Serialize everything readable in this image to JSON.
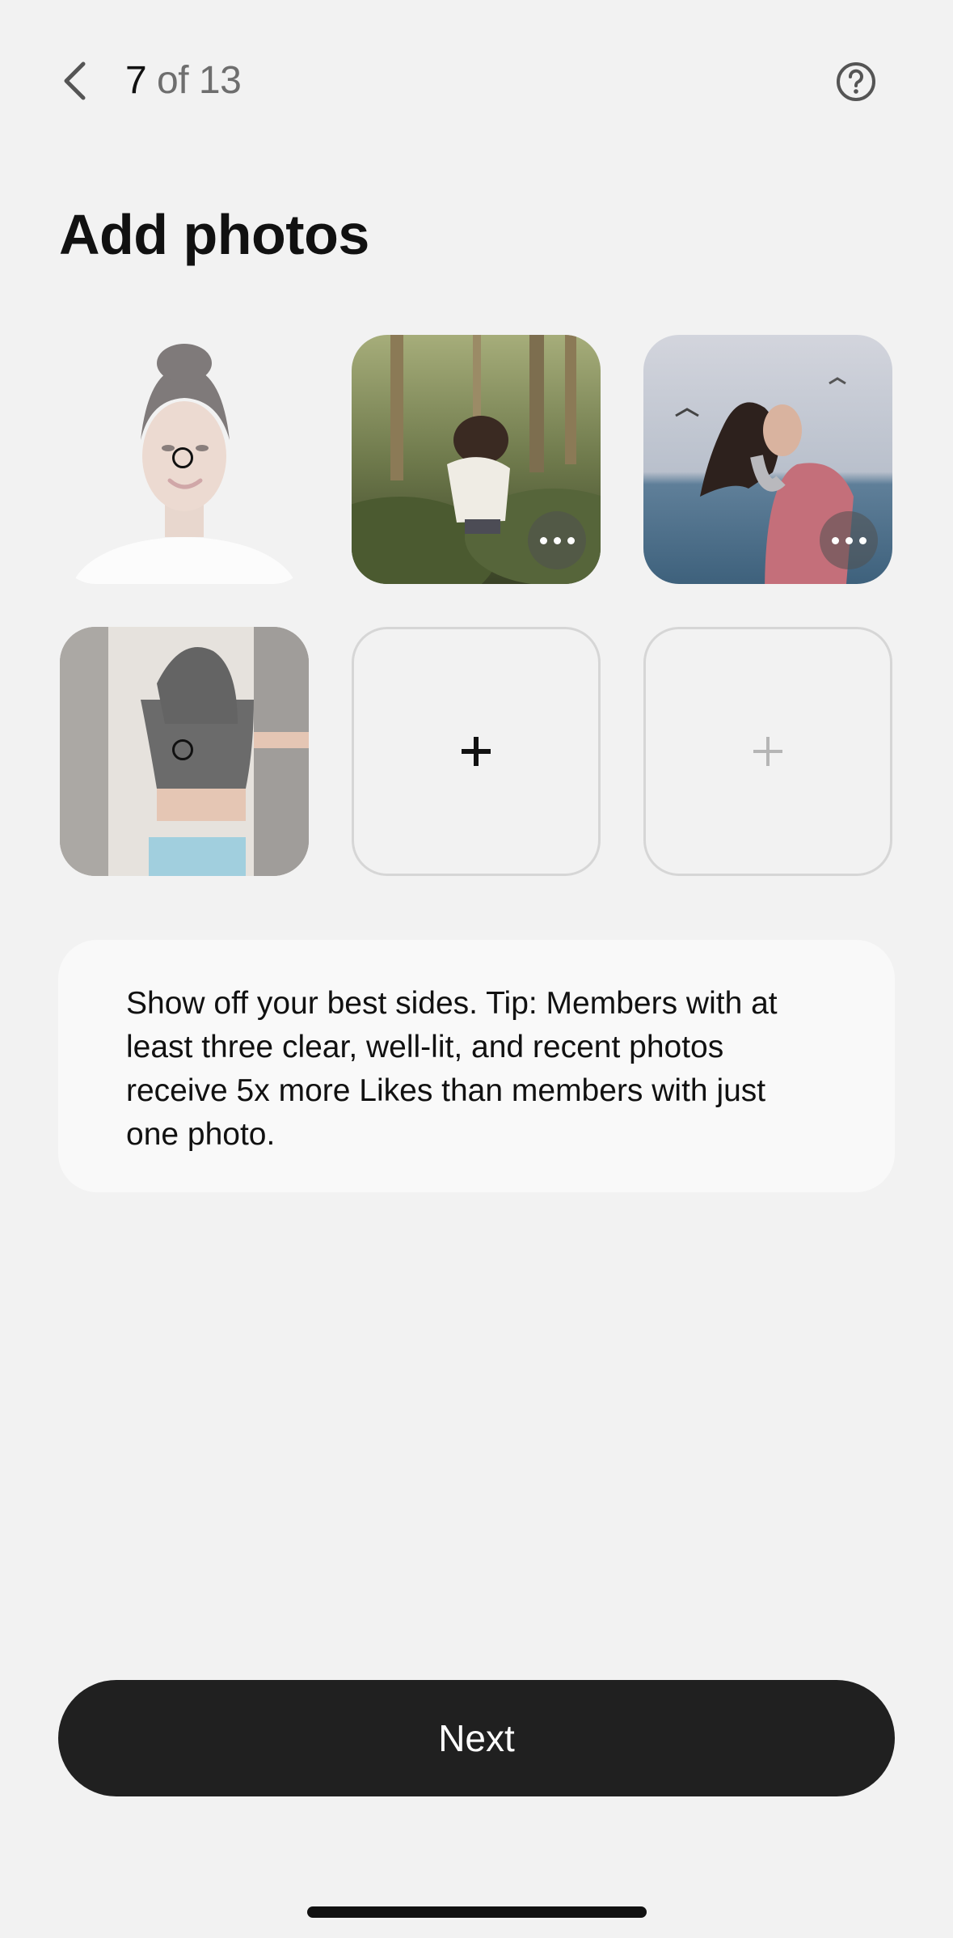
{
  "header": {
    "back_icon": "chevron-left-icon",
    "step_current": "7",
    "step_rest": " of 13",
    "help_icon": "question-circle-icon"
  },
  "title": "Add photos",
  "photos": {
    "more_icon": "ellipsis-icon",
    "add_icon": "plus-icon",
    "add_icon_color_active": "#111111",
    "add_icon_color_disabled": "#b5b5b5"
  },
  "tip": {
    "text": "Show off your best sides. Tip: Members with at least three clear, well-lit, and recent photos receive 5x more Likes than members with just one photo."
  },
  "footer": {
    "next_label": "Next"
  },
  "colors": {
    "background": "#f2f2f2",
    "button": "#202020",
    "card": "#f9f9f9"
  }
}
